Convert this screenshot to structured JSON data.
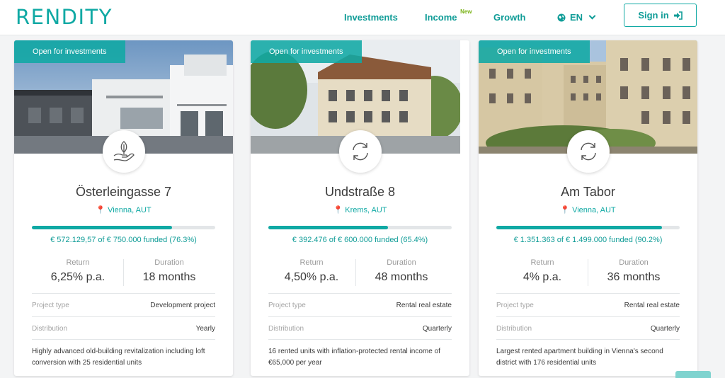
{
  "header": {
    "logo": "RENDITY",
    "nav": [
      "Investments",
      "Income",
      "Growth"
    ],
    "new_badge": "New",
    "language": "EN",
    "signin": "Sign in"
  },
  "colors": {
    "accent": "#10a9a4",
    "new_badge": "#7ab317"
  },
  "projects": [
    {
      "status": "Open for investments",
      "icon": "plant-in-hand-icon",
      "title": "Österleingasse 7",
      "location": "Vienna, AUT",
      "funded_fraction": 0.763,
      "funded_text": "€ 572.129,57 of € 750.000 funded (76.3%)",
      "return_label": "Return",
      "return_value": "6,25% p.a.",
      "duration_label": "Duration",
      "duration_value": "18 months",
      "type_label": "Project type",
      "type_value": "Development project",
      "distribution_label": "Distribution",
      "distribution_value": "Yearly",
      "description": "Highly advanced old-building revitalization including loft conversion with 25 residential units"
    },
    {
      "status": "Open for investments",
      "icon": "refresh-icon",
      "title": "Undstraße 8",
      "location": "Krems, AUT",
      "funded_fraction": 0.654,
      "funded_text": "€ 392.476 of € 600.000 funded (65.4%)",
      "return_label": "Return",
      "return_value": "4,50% p.a.",
      "duration_label": "Duration",
      "duration_value": "48 months",
      "type_label": "Project type",
      "type_value": "Rental real estate",
      "distribution_label": "Distribution",
      "distribution_value": "Quarterly",
      "description": "16 rented units with inflation-protected rental income of €65,000 per year"
    },
    {
      "status": "Open for investments",
      "icon": "refresh-icon",
      "title": "Am Tabor",
      "location": "Vienna, AUT",
      "funded_fraction": 0.902,
      "funded_text": "€ 1.351.363 of € 1.499.000 funded (90.2%)",
      "return_label": "Return",
      "return_value": "4% p.a.",
      "duration_label": "Duration",
      "duration_value": "36 months",
      "type_label": "Project type",
      "type_value": "Rental real estate",
      "distribution_label": "Distribution",
      "distribution_value": "Quarterly",
      "description": "Largest rented apartment building in Vienna's second district with 176 residential units"
    }
  ]
}
